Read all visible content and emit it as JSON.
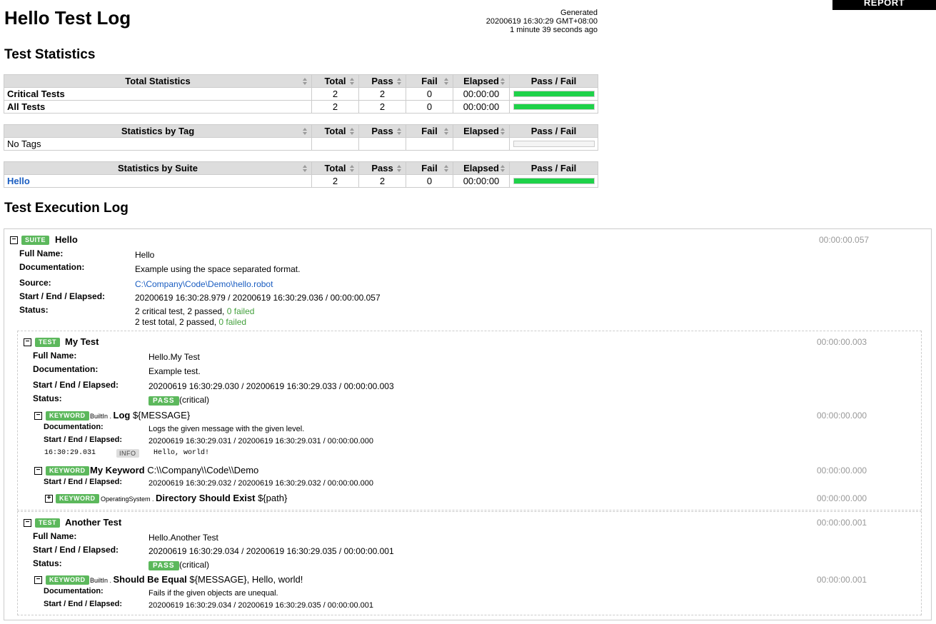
{
  "header": {
    "title": "Hello Test Log",
    "generated_label": "Generated",
    "generated_time": "20200619 16:30:29 GMT+08:00",
    "generated_ago": "1 minute 39 seconds ago",
    "report_link": "REPORT"
  },
  "sections": {
    "statistics": "Test Statistics",
    "execution": "Test Execution Log"
  },
  "columns": [
    "Total",
    "Pass",
    "Fail",
    "Elapsed",
    "Pass / Fail"
  ],
  "stats_total": {
    "header": "Total Statistics",
    "rows": [
      {
        "name": "Critical Tests",
        "total": "2",
        "pass": "2",
        "fail": "0",
        "elapsed": "00:00:00",
        "pass_ratio": 1.0
      },
      {
        "name": "All Tests",
        "total": "2",
        "pass": "2",
        "fail": "0",
        "elapsed": "00:00:00",
        "pass_ratio": 1.0
      }
    ]
  },
  "stats_tag": {
    "header": "Statistics by Tag",
    "rows": [
      {
        "name": "No Tags",
        "total": "",
        "pass": "",
        "fail": "",
        "elapsed": "",
        "pass_ratio": 0
      }
    ]
  },
  "stats_suite": {
    "header": "Statistics by Suite",
    "rows": [
      {
        "name": "Hello",
        "total": "2",
        "pass": "2",
        "fail": "0",
        "elapsed": "00:00:00",
        "pass_ratio": 1.0
      }
    ]
  },
  "colors": {
    "pass": "#1ed249",
    "label_green": "#5cb85c",
    "link": "#1a5dc1"
  },
  "suite": {
    "badge": "SUITE",
    "name": "Hello",
    "elapsed": "00:00:00.057",
    "full_name_label": "Full Name:",
    "full_name": "Hello",
    "doc_label": "Documentation:",
    "doc": "Example using the space separated format.",
    "source_label": "Source:",
    "source": "C:\\Company\\Code\\Demo\\hello.robot",
    "times_label": "Start / End / Elapsed:",
    "times": "20200619 16:30:28.979 / 20200619 16:30:29.036 / 00:00:00.057",
    "status_label": "Status:",
    "status_line1": "2 critical test, 2 passed, ",
    "status_line1_fail": "0 failed",
    "status_line2": "2 test total, 2 passed, ",
    "status_line2_fail": "0 failed"
  },
  "test1": {
    "badge": "TEST",
    "name": "My Test",
    "elapsed": "00:00:00.003",
    "full_name_label": "Full Name:",
    "full_name": "Hello.My Test",
    "doc_label": "Documentation:",
    "doc": "Example test.",
    "times_label": "Start / End / Elapsed:",
    "times": "20200619 16:30:29.030 / 20200619 16:30:29.033 / 00:00:00.003",
    "status_label": "Status:",
    "status": "PASS",
    "critical": "(critical)",
    "kw1": {
      "badge": "KEYWORD",
      "lib": "BuiltIn . ",
      "name": "Log",
      "args": " ${MESSAGE}",
      "elapsed": "00:00:00.000",
      "doc_label": "Documentation:",
      "doc": "Logs the given message with the given level.",
      "times_label": "Start / End / Elapsed:",
      "times": "20200619 16:30:29.031 / 20200619 16:30:29.031 / 00:00:00.000",
      "msg_time": "16:30:29.031",
      "msg_level": "INFO",
      "msg_text": "Hello, world!"
    },
    "kw2": {
      "badge": "KEYWORD",
      "name": "My Keyword",
      "args": " C:\\\\Company\\\\Code\\\\Demo",
      "elapsed": "00:00:00.000",
      "times_label": "Start / End / Elapsed:",
      "times": "20200619 16:30:29.032 / 20200619 16:30:29.032 / 00:00:00.000",
      "sub": {
        "badge": "KEYWORD",
        "lib": "OperatingSystem . ",
        "name": "Directory Should Exist",
        "args": " ${path}",
        "elapsed": "00:00:00.000"
      }
    }
  },
  "test2": {
    "badge": "TEST",
    "name": "Another Test",
    "elapsed": "00:00:00.001",
    "full_name_label": "Full Name:",
    "full_name": "Hello.Another Test",
    "times_label": "Start / End / Elapsed:",
    "times": "20200619 16:30:29.034 / 20200619 16:30:29.035 / 00:00:00.001",
    "status_label": "Status:",
    "status": "PASS",
    "critical": "(critical)",
    "kw1": {
      "badge": "KEYWORD",
      "lib": "BuiltIn . ",
      "name": "Should Be Equal",
      "args": " ${MESSAGE}, Hello, world!",
      "elapsed": "00:00:00.001",
      "doc_label": "Documentation:",
      "doc": "Fails if the given objects are unequal.",
      "times_label": "Start / End / Elapsed:",
      "times": "20200619 16:30:29.034 / 20200619 16:30:29.035 / 00:00:00.001"
    }
  },
  "toggle_symbols": {
    "expanded": "−",
    "collapsed": "+"
  }
}
